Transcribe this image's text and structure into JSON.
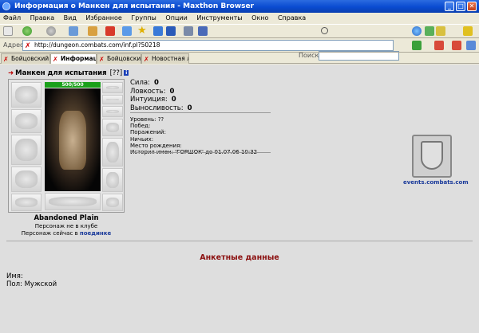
{
  "window": {
    "title": "Информация о Манкен для испытания - Maxthon Browser"
  },
  "menu": [
    "Файл",
    "Правка",
    "Вид",
    "Избранное",
    "Группы",
    "Опции",
    "Инструменты",
    "Окно",
    "Справка"
  ],
  "toolbar": {
    "search_label": "Поиск:",
    "search_value": ""
  },
  "address": {
    "label": "Адрес",
    "url": "http://dungeon.combats.com/inf.pl?50218"
  },
  "tabs": [
    {
      "label": "Бойцовский ...",
      "active": false
    },
    {
      "label": "Информац...",
      "active": true
    },
    {
      "label": "Бойцовский ...",
      "active": false
    },
    {
      "label": "Новостная л...",
      "active": false
    }
  ],
  "character": {
    "name": "Манкен для испытания",
    "help_marker": "[??]",
    "hp": "500/500",
    "hp_fraction": 1.0,
    "location": "Abandoned Plain",
    "club_status": "Персонаж не в клубе",
    "duel_prefix": "Персонаж сейчас в",
    "duel_link": "поединке"
  },
  "stats": [
    {
      "label": "Сила:",
      "value": "0"
    },
    {
      "label": "Ловкость:",
      "value": "0"
    },
    {
      "label": "Интуиция:",
      "value": "0"
    },
    {
      "label": "Выносливость:",
      "value": "0"
    }
  ],
  "info": [
    "Уровень: ??",
    "Побед:",
    "Поражений:",
    "Ничьих:",
    "Место рождения:",
    "История имен: 'ГОРШОК' до 01.07.06 10:32"
  ],
  "emblem": {
    "caption": "events.combats.com"
  },
  "profile": {
    "section_title": "Анкетные данные",
    "name_label": "Имя:",
    "gender_label": "Пол:",
    "gender_value": "Мужской"
  }
}
